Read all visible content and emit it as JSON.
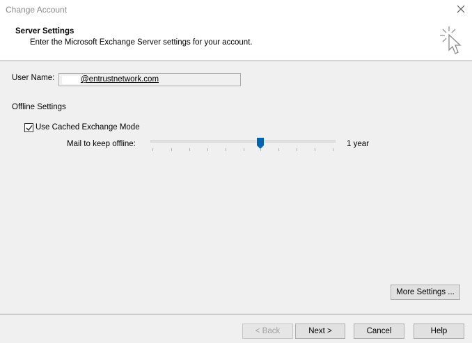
{
  "window": {
    "title": "Change Account"
  },
  "header": {
    "title": "Server Settings",
    "subtitle": "Enter the Microsoft Exchange Server settings for your account."
  },
  "user": {
    "label": "User Name:",
    "value": "@entrustnetwork.com"
  },
  "offline": {
    "section_label": "Offline Settings",
    "cached_label": "Use Cached Exchange Mode",
    "cached_checked": true,
    "mail_keep_label": "Mail to keep offline:",
    "mail_keep_value": "1 year"
  },
  "buttons": {
    "more_settings": "More Settings ...",
    "back": "< Back",
    "next": "Next >",
    "cancel": "Cancel",
    "help": "Help"
  },
  "colors": {
    "accent": "#0063b1"
  },
  "icons": {
    "close": "close-icon",
    "wizard": "cursor-click-icon",
    "check": "check-icon"
  }
}
